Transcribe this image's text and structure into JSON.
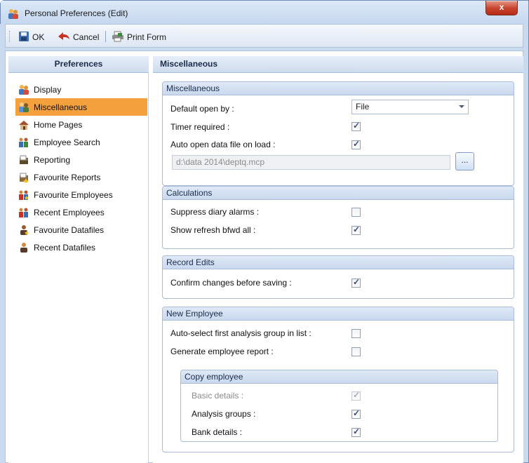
{
  "window": {
    "title": "Personal Preferences (Edit)",
    "close_label": "x"
  },
  "toolbar": {
    "ok_label": "OK",
    "cancel_label": "Cancel",
    "print_label": "Print Form"
  },
  "sidebar": {
    "header": "Preferences",
    "items": [
      {
        "label": "Display",
        "icon": "display-icon"
      },
      {
        "label": "Miscellaneous",
        "icon": "miscellaneous-icon"
      },
      {
        "label": "Home Pages",
        "icon": "home-pages-icon"
      },
      {
        "label": "Employee Search",
        "icon": "employee-search-icon"
      },
      {
        "label": "Reporting",
        "icon": "reporting-icon"
      },
      {
        "label": "Favourite Reports",
        "icon": "favourite-reports-icon"
      },
      {
        "label": "Favourite Employees",
        "icon": "favourite-employees-icon"
      },
      {
        "label": "Recent Employees",
        "icon": "recent-employees-icon"
      },
      {
        "label": "Favourite Datafiles",
        "icon": "favourite-datafiles-icon"
      },
      {
        "label": "Recent Datafiles",
        "icon": "recent-datafiles-icon"
      }
    ],
    "selected": "Miscellaneous"
  },
  "main": {
    "header": "Miscellaneous",
    "misc": {
      "title": "Miscellaneous",
      "default_open_label": "Default open by :",
      "default_open_value": "File",
      "timer_label": "Timer required :",
      "timer_checked": true,
      "auto_open_label": "Auto open data file on load :",
      "auto_open_checked": true,
      "path_value": "d:\\data 2014\\deptq.mcp",
      "browse_label": "..."
    },
    "calculations": {
      "title": "Calculations",
      "suppress_label": "Suppress diary alarms :",
      "suppress_checked": false,
      "show_refresh_label": "Show refresh bfwd all :",
      "show_refresh_checked": true
    },
    "record_edits": {
      "title": "Record Edits",
      "confirm_label": "Confirm changes before saving :",
      "confirm_checked": true
    },
    "new_employee": {
      "title": "New Employee",
      "auto_select_label": "Auto-select first analysis group in list :",
      "auto_select_checked": false,
      "generate_report_label": "Generate employee report :",
      "generate_report_checked": false,
      "copy": {
        "title": "Copy employee",
        "basic_label": "Basic details :",
        "basic_checked": true,
        "analysis_label": "Analysis groups :",
        "analysis_checked": true,
        "bank_label": "Bank details :",
        "bank_checked": true
      }
    }
  },
  "colors": {
    "selected_item": "#f4a03c",
    "frame": "#c9daee",
    "close_button": "#c7422c"
  }
}
